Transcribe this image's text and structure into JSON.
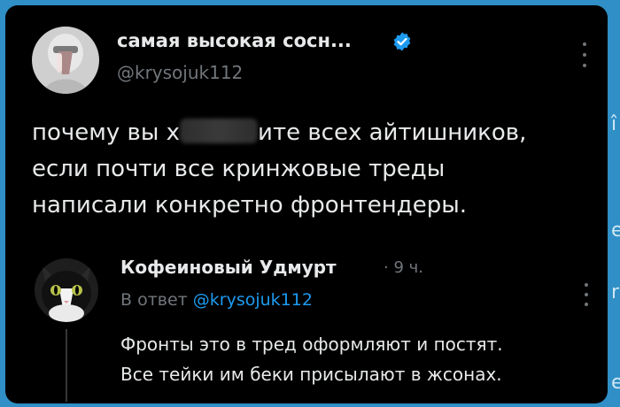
{
  "post": {
    "author_name": "самая высокая сосн...",
    "author_handle": "@krysojuk112",
    "lines": [
      {
        "before": "почему вы х",
        "after": "ите всех айтишников,"
      },
      {
        "text": "если почти все кринжовые треды"
      },
      {
        "text": "написали конкретно фронтендеры."
      }
    ]
  },
  "reply": {
    "author_name": "Кофеиновый Удмурт",
    "meta": "· 9 ч.",
    "reply_prefix": "В ответ",
    "reply_to": "@krysojuk112",
    "lines": [
      "Фронты это в тред оформляют и постят.",
      "Все тейки им беки присылают в жсонах."
    ]
  },
  "icons": {
    "verified": "verified-badge-icon",
    "more": "more-options-icon"
  },
  "colors": {
    "background": "#000000",
    "text": "#e7e9ea",
    "secondary": "#71767b",
    "accent": "#1d9bf0",
    "page_bg": "#2f8fc6"
  }
}
